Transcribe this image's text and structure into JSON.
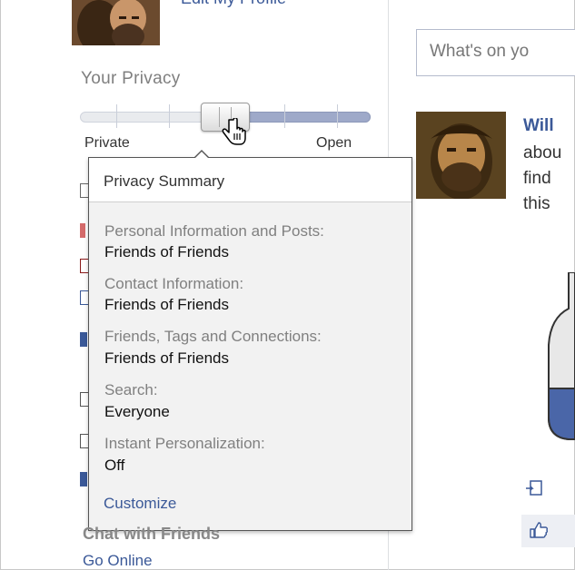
{
  "left": {
    "edit_profile_link": "Edit My Profile",
    "privacy": {
      "heading": "Your Privacy",
      "slider": {
        "min_label": "Private",
        "max_label": "Open",
        "level_fraction": 0.5
      }
    },
    "popup": {
      "title": "Privacy Summary",
      "items": [
        {
          "label": "Personal Information and Posts:",
          "value": "Friends of Friends"
        },
        {
          "label": "Contact Information:",
          "value": "Friends of Friends"
        },
        {
          "label": "Friends, Tags and Connections:",
          "value": "Friends of Friends"
        },
        {
          "label": "Search:",
          "value": "Everyone"
        },
        {
          "label": "Instant Personalization:",
          "value": "Off"
        }
      ],
      "customize_link": "Customize"
    },
    "chat": {
      "heading": "Chat with Friends",
      "go_online_link": "Go Online"
    }
  },
  "right": {
    "status_placeholder": "What's on yo",
    "story": {
      "name": "Will",
      "lines": [
        "abou",
        "find",
        "this"
      ]
    }
  },
  "colors": {
    "link": "#3b5998",
    "slider_fill": "#9ea9c9",
    "popup_bg": "#f2f2f2"
  }
}
